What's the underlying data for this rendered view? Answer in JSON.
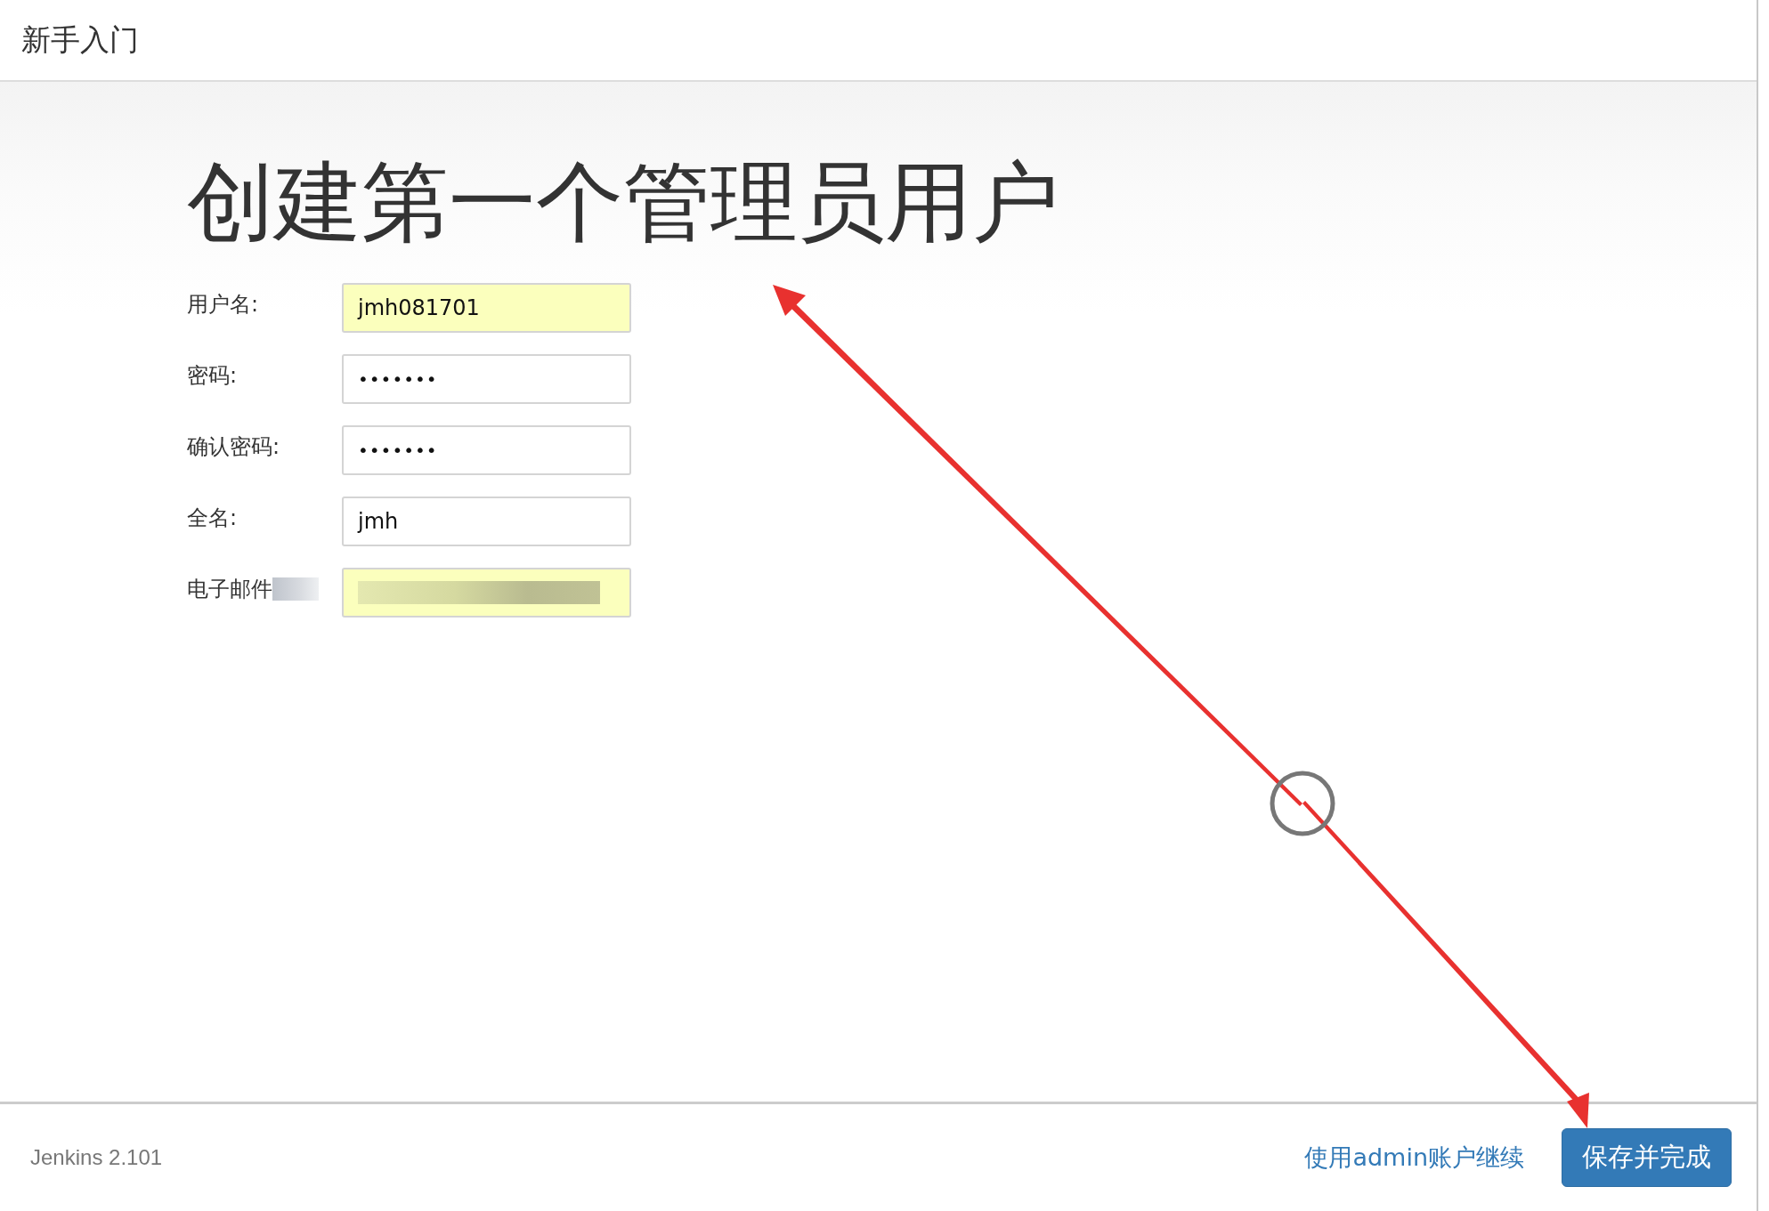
{
  "header": {
    "title": "新手入门"
  },
  "heading": "创建第一个管理员用户",
  "form_fields": [
    {
      "label": "用户名:",
      "kind": "text",
      "value": "jmh081701",
      "highlighted": true
    },
    {
      "label": "密码:",
      "kind": "password",
      "value": "•••••••",
      "highlighted": false
    },
    {
      "label": "确认密码:",
      "kind": "password",
      "value": "•••••••",
      "highlighted": false
    },
    {
      "label": "全名:",
      "kind": "text",
      "value": "jmh",
      "highlighted": false
    },
    {
      "label": "电子邮件",
      "kind": "redacted",
      "highlighted": true
    }
  ],
  "footer": {
    "version": "Jenkins 2.101",
    "link": "使用admin账户继续",
    "button": "保存并完成"
  }
}
